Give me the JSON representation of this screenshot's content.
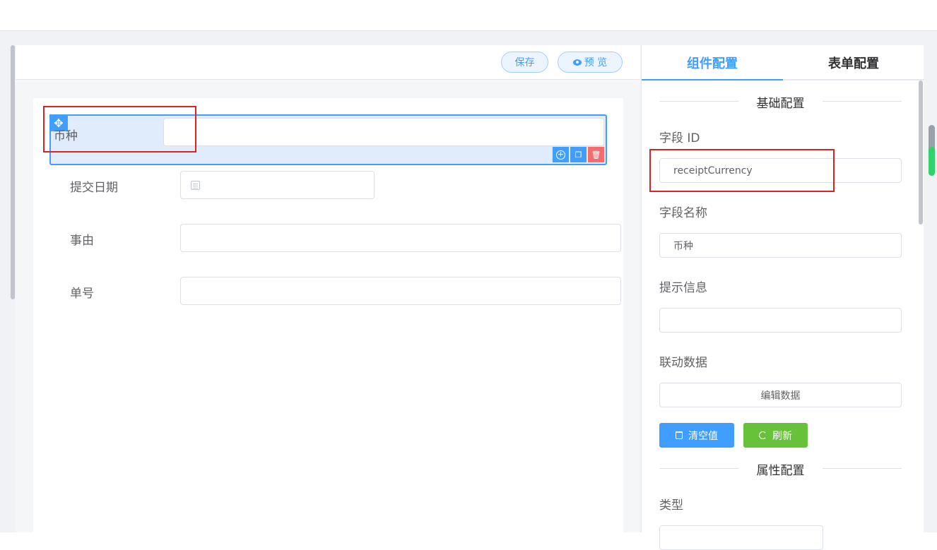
{
  "toolbar": {
    "save_label": "保存",
    "preview_label": "预 览"
  },
  "form": {
    "fields": [
      {
        "label": "币种"
      },
      {
        "label": "提交日期"
      },
      {
        "label": "事由"
      },
      {
        "label": "单号"
      }
    ]
  },
  "panel": {
    "tabs": [
      {
        "label": "组件配置",
        "active": true
      },
      {
        "label": "表单配置",
        "active": false
      }
    ],
    "basic_section": "基础配置",
    "field_id_label": "字段 ID",
    "field_id_value": "receiptCurrency",
    "field_name_label": "字段名称",
    "field_name_value": "币种",
    "hint_label": "提示信息",
    "hint_value": "",
    "linkage_label": "联动数据",
    "edit_data_label": "编辑数据",
    "clear_label": "清空值",
    "refresh_label": "刷新",
    "attr_section": "属性配置",
    "type_label": "类型"
  },
  "colors": {
    "primary": "#409eff",
    "success": "#67c23a",
    "danger": "#f56c6c",
    "highlight": "#e02020"
  }
}
